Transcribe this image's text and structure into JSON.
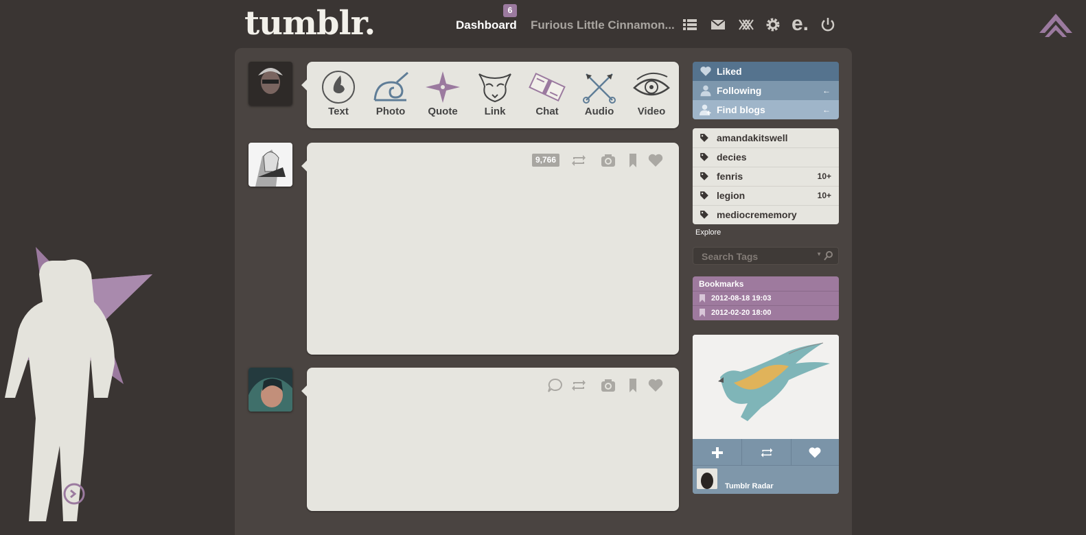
{
  "header": {
    "logo": "tumblr.",
    "dashboard_label": "Dashboard",
    "dashboard_badge": "6",
    "blog_name": "Furious Little Cinnamon...",
    "icons": [
      "list-icon",
      "mail-icon",
      "xkit-icon",
      "gear-icon",
      "edit-e-icon",
      "power-icon"
    ]
  },
  "post_types": [
    {
      "label": "Text",
      "icon": "ink-drop-icon"
    },
    {
      "label": "Photo",
      "icon": "leaf-swirl-icon"
    },
    {
      "label": "Quote",
      "icon": "shuriken-icon"
    },
    {
      "label": "Link",
      "icon": "fox-mask-icon"
    },
    {
      "label": "Chat",
      "icon": "scroll-icon"
    },
    {
      "label": "Audio",
      "icon": "crossed-kunai-icon"
    },
    {
      "label": "Video",
      "icon": "sharingan-eye-icon"
    }
  ],
  "posts": [
    {
      "notes": "9,766",
      "controls": [
        "reblog-icon",
        "camera-icon",
        "bookmark-icon",
        "heart-icon"
      ]
    },
    {
      "controls": [
        "reply-icon",
        "reblog-icon",
        "camera-icon",
        "bookmark-icon",
        "heart-icon"
      ]
    }
  ],
  "sidebar": {
    "nav": [
      {
        "label": "Liked",
        "icon": "heart-icon",
        "color": "#55738e"
      },
      {
        "label": "Following",
        "icon": "person-icon",
        "arrow": "←",
        "color": "#7d97ad"
      },
      {
        "label": "Find blogs",
        "icon": "add-person-icon",
        "arrow": "←",
        "color": "#9fb5c9"
      }
    ],
    "tags": [
      {
        "label": "amandakitswell",
        "count": ""
      },
      {
        "label": "decies",
        "count": ""
      },
      {
        "label": "fenris",
        "count": "10+"
      },
      {
        "label": "legion",
        "count": "10+"
      },
      {
        "label": "mediocrememory",
        "count": ""
      }
    ],
    "explore": "Explore",
    "search_placeholder": "Search Tags",
    "bookmarks": {
      "title": "Bookmarks",
      "items": [
        "2012-08-18 19:03",
        "2012-02-20 18:00"
      ]
    },
    "radar": {
      "label": "Tumblr Radar"
    }
  },
  "colors": {
    "background": "#3a3533",
    "panel": "#4a4441",
    "card": "#e6e5df",
    "accent_purple": "#9b7a9f",
    "blue": "#7d97ad"
  }
}
